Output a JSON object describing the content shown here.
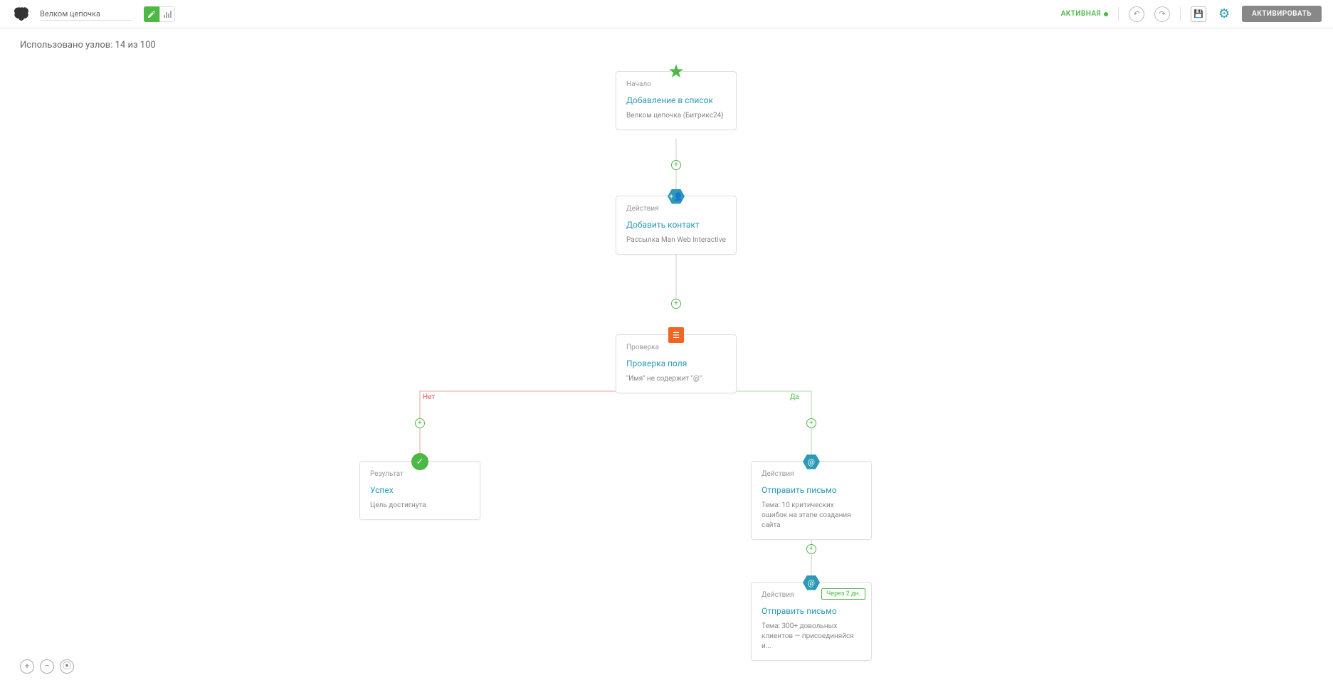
{
  "header": {
    "title": "Велком цепочка",
    "status": "АКТИВНАЯ",
    "activate_btn": "АКТИВИРОВАТЬ"
  },
  "nodes_used": "Использовано узлов: 14 из 100",
  "branch": {
    "no": "Нет",
    "yes": "Да"
  },
  "nodes": {
    "start": {
      "type": "Начало",
      "title": "Добавление в список",
      "desc": "Велком цепочка (Битрикс24)"
    },
    "add_contact": {
      "type": "Действия",
      "title": "Добавить контакт",
      "desc": "Рассылка Man Web Interactive"
    },
    "check_field": {
      "type": "Проверка",
      "title": "Проверка поля",
      "desc": "\"Имя\" не содержит \"@\""
    },
    "success": {
      "type": "Результат",
      "title": "Успех",
      "desc": "Цель достигнута"
    },
    "send1": {
      "type": "Действия",
      "title": "Отправить письмо",
      "desc": "Тема: 10 критических ошибок на этапе создания сайта"
    },
    "send2": {
      "type": "Действия",
      "title": "Отправить письмо",
      "desc": "Тема: 300+ довольных клиентов — присоединяйся и...",
      "delay": "Через 2 дн."
    }
  }
}
